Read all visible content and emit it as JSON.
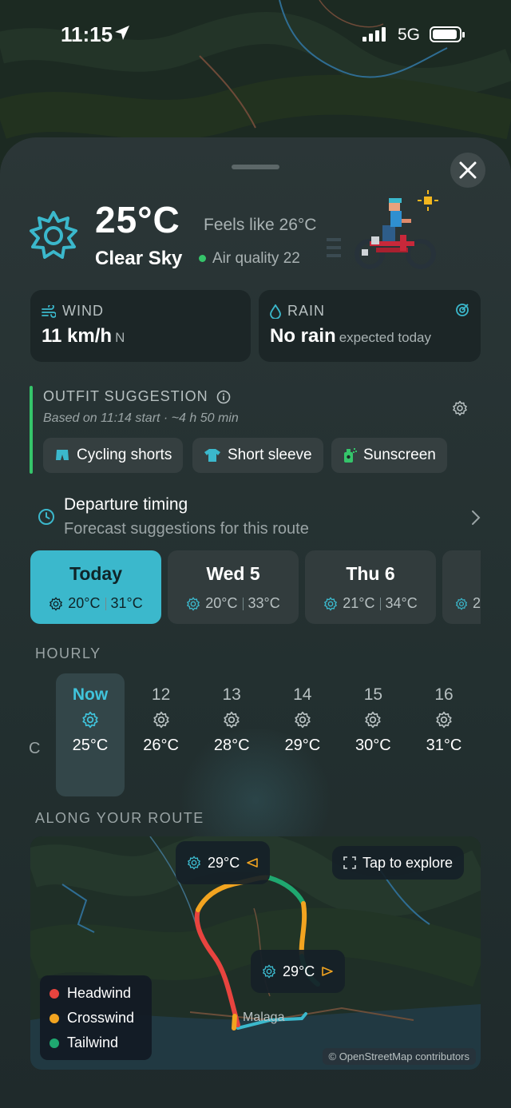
{
  "status_bar": {
    "time": "11:15",
    "network": "5G"
  },
  "weather": {
    "temperature": "25°C",
    "feels_like": "Feels like 26°C",
    "condition": "Clear Sky",
    "air_quality": "Air quality 22"
  },
  "wind": {
    "label": "WIND",
    "value": "11 km/h",
    "direction": "N"
  },
  "rain": {
    "label": "RAIN",
    "value": "No rain",
    "note": "expected today"
  },
  "outfit": {
    "title": "OUTFIT SUGGESTION",
    "subtitle": "Based on 11:14 start · ~4 h 50 min",
    "items": [
      "Cycling shorts",
      "Short sleeve",
      "Sunscreen"
    ]
  },
  "departure": {
    "title": "Departure timing",
    "subtitle": "Forecast suggestions for this route",
    "days": [
      {
        "name": "Today",
        "low": "20°C",
        "high": "31°C"
      },
      {
        "name": "Wed 5",
        "low": "20°C",
        "high": "33°C"
      },
      {
        "name": "Thu 6",
        "low": "21°C",
        "high": "34°C"
      },
      {
        "partial": "2"
      }
    ]
  },
  "hourly": {
    "label": "HOURLY",
    "edge_text": "C",
    "hours": [
      {
        "label": "Now",
        "temp": "25°C"
      },
      {
        "label": "12",
        "temp": "26°C"
      },
      {
        "label": "13",
        "temp": "28°C"
      },
      {
        "label": "14",
        "temp": "29°C"
      },
      {
        "label": "15",
        "temp": "30°C"
      },
      {
        "label": "16",
        "temp": "31°C"
      }
    ]
  },
  "route": {
    "label": "ALONG YOUR ROUTE",
    "badge_top": "29°C",
    "badge_bottom": "29°C",
    "explore": "Tap to explore",
    "place": "Malaga",
    "legend": [
      "Headwind",
      "Crosswind",
      "Tailwind"
    ],
    "attribution": "© OpenStreetMap contributors",
    "colors": {
      "headwind": "#e8443f",
      "crosswind": "#f2a420",
      "tailwind": "#1fa870",
      "accent": "#3bb8cc"
    }
  }
}
